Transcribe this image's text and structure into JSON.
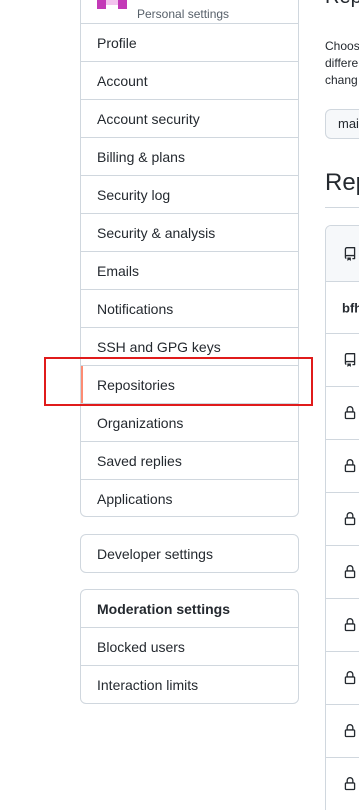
{
  "sidebar": {
    "header_label": "Personal settings",
    "items": [
      {
        "label": "Profile"
      },
      {
        "label": "Account"
      },
      {
        "label": "Account security"
      },
      {
        "label": "Billing & plans"
      },
      {
        "label": "Security log"
      },
      {
        "label": "Security & analysis"
      },
      {
        "label": "Emails"
      },
      {
        "label": "Notifications"
      },
      {
        "label": "SSH and GPG keys"
      },
      {
        "label": "Repositories",
        "selected": true
      },
      {
        "label": "Organizations"
      },
      {
        "label": "Saved replies"
      },
      {
        "label": "Applications"
      }
    ]
  },
  "developer": {
    "label": "Developer settings"
  },
  "moderation": {
    "heading": "Moderation settings",
    "items": [
      {
        "label": "Blocked users"
      },
      {
        "label": "Interaction limits"
      }
    ]
  },
  "main": {
    "top_heading": "Rep",
    "description": "Choos\ndiffere\nchang",
    "branch_value": "mai",
    "repos_heading": "Rep",
    "table": {
      "header_icon": "repo-icon",
      "subheader_text": "bfh",
      "rows": [
        {
          "icon": "repo-icon"
        },
        {
          "icon": "lock-icon"
        },
        {
          "icon": "lock-icon"
        },
        {
          "icon": "lock-icon"
        },
        {
          "icon": "lock-icon"
        },
        {
          "icon": "lock-icon"
        },
        {
          "icon": "lock-icon"
        },
        {
          "icon": "lock-icon"
        },
        {
          "icon": "lock-icon"
        }
      ]
    }
  },
  "colors": {
    "accent_selected": "#fd8c73",
    "highlight_annotation": "#e01b1b",
    "avatar": "#c33ab7"
  }
}
